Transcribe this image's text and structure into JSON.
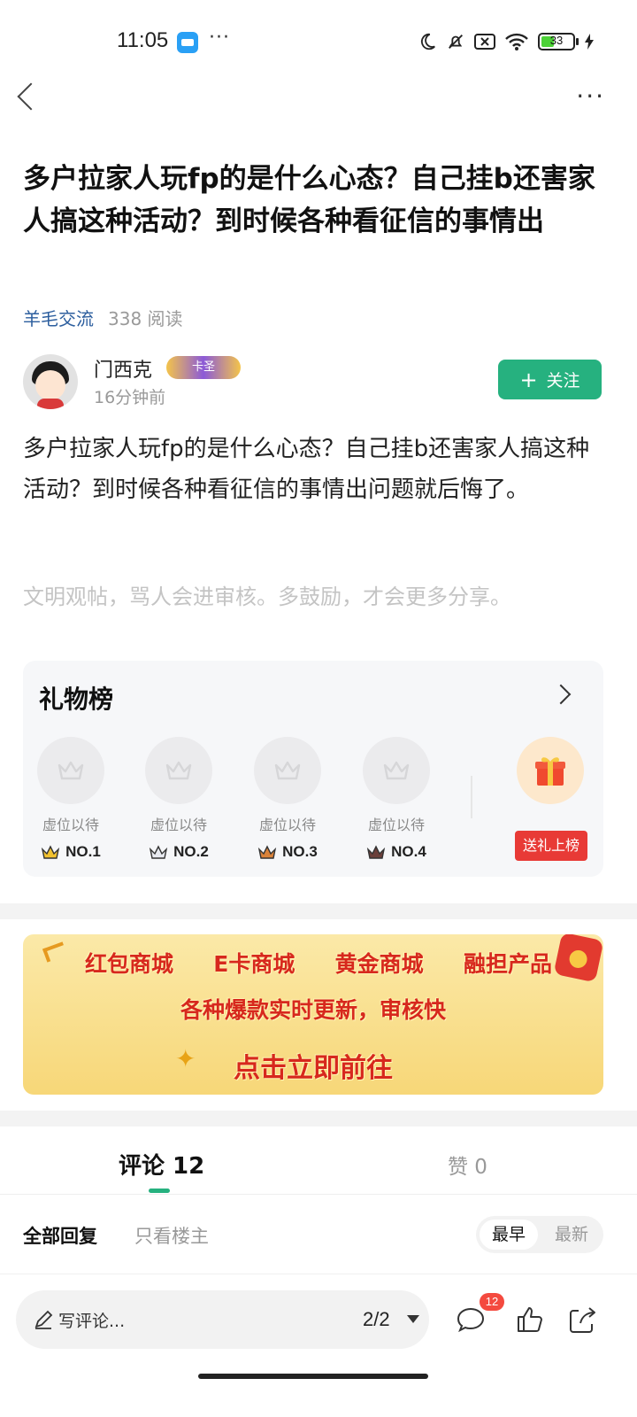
{
  "status_bar": {
    "time": "11:05",
    "dots": "···",
    "icons": [
      "moon-icon",
      "bell-off-icon",
      "sim-off-icon",
      "wifi-icon",
      "battery-icon",
      "charging-icon"
    ],
    "battery_level": "33"
  },
  "nav": {
    "back_icon": "chevron-left-icon",
    "more_icon": "more-dots-icon",
    "more_label": "···"
  },
  "post": {
    "title": "多户拉家人玩fp的是什么心态？自己挂b还害家人搞这种活动？到时候各种看征信的事情出",
    "category": "羊毛交流",
    "reads": "338 阅读",
    "author": {
      "name": "门西克",
      "badge": "卡圣",
      "time": "16分钟前"
    },
    "follow_label": "关注",
    "body": "多户拉家人玩fp的是什么心态？自己挂b还害家人搞这种活动？到时候各种看征信的事情出问题就后悔了。",
    "civility_notice": "文明观帖，骂人会进审核。多鼓励，才会更多分享。"
  },
  "gift_board": {
    "title": "礼物榜",
    "slots": [
      {
        "label": "虚位以待",
        "rank": "NO.1",
        "crown_color": "#f2c230"
      },
      {
        "label": "虚位以待",
        "rank": "NO.2",
        "crown_color": "#555a66"
      },
      {
        "label": "虚位以待",
        "rank": "NO.3",
        "crown_color": "#d9823a"
      },
      {
        "label": "虚位以待",
        "rank": "NO.4",
        "crown_color": "#6b3f3a"
      }
    ],
    "send_label": "送礼上榜"
  },
  "banner": {
    "items": [
      "红包商城",
      "E卡商城",
      "黄金商城",
      "融担产品"
    ],
    "line2": "各种爆款实时更新，审核快",
    "cta": "点击立即前往"
  },
  "tabs": {
    "comments": "评论 12",
    "likes": "赞 0"
  },
  "filters": {
    "all": "全部回复",
    "op_only": "只看楼主",
    "sort_earliest": "最早",
    "sort_latest": "最新"
  },
  "bottom_bar": {
    "placeholder": "写评论...",
    "page": "2/2",
    "comment_count": "12"
  },
  "colors": {
    "accent": "#26b17f",
    "link": "#2c5e9e",
    "badge_red": "#f44a3f",
    "gift_red": "#e83a36"
  }
}
